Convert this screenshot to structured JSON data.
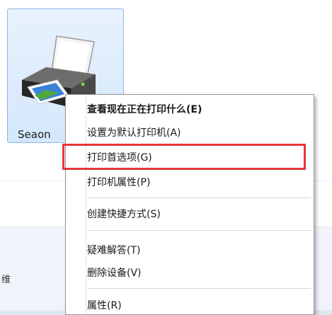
{
  "device": {
    "label": "Seaon",
    "icon": "printer-icon"
  },
  "context_menu": {
    "items": [
      {
        "label": "查看现在正在打印什么(E)",
        "bold": true
      },
      {
        "label": "设置为默认打印机(A)"
      },
      {
        "label": "打印首选项(G)",
        "annotated": true
      },
      {
        "label": "打印机属性(P)"
      },
      {
        "label": "创建快捷方式(S)"
      },
      {
        "label": "疑难解答(T)"
      },
      {
        "label": "删除设备(V)"
      },
      {
        "label": "属性(R)"
      }
    ]
  },
  "side_glyph": "维",
  "colors": {
    "annotation": "#e5363a",
    "selection_tile": "#d4e7fb",
    "selection_border": "#8eb8e6"
  }
}
